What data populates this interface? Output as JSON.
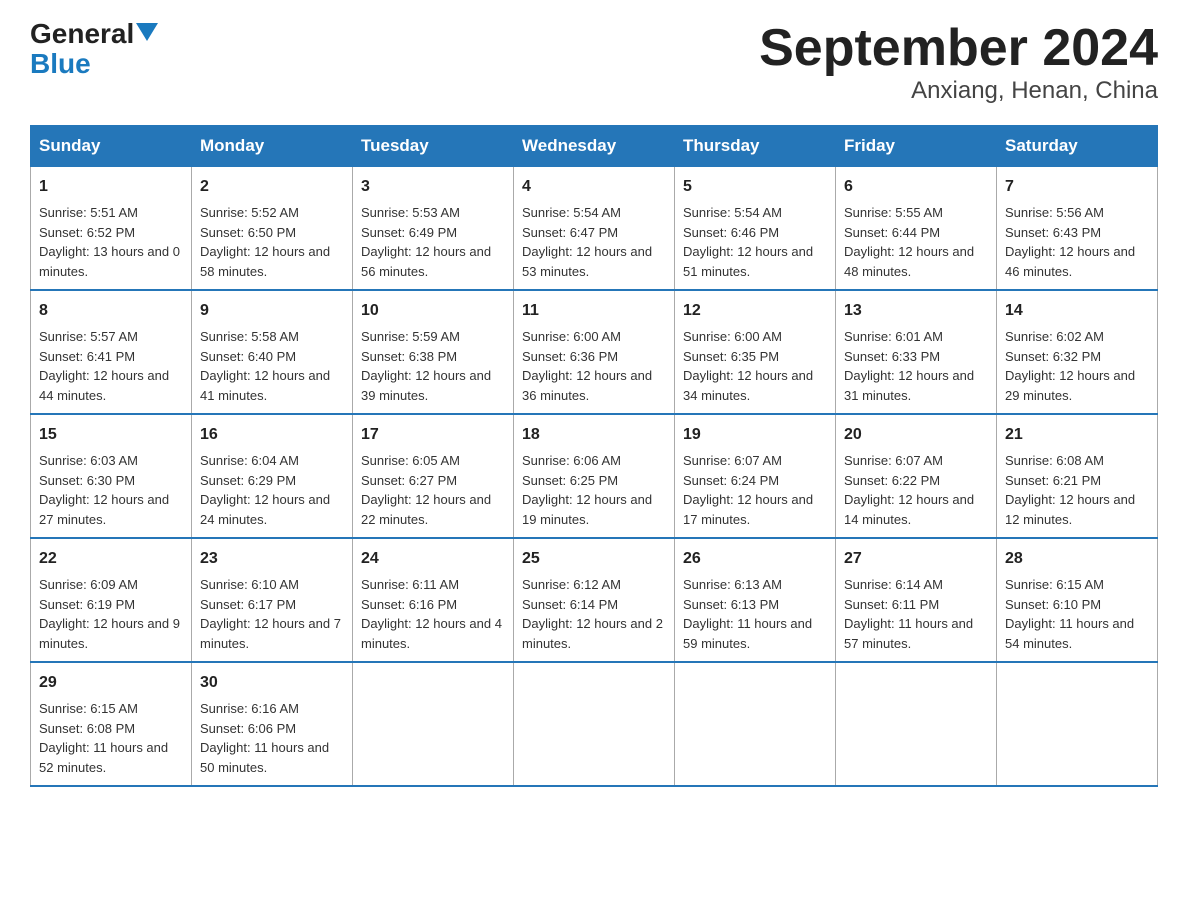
{
  "header": {
    "logo_general": "General",
    "logo_blue": "Blue",
    "title": "September 2024",
    "subtitle": "Anxiang, Henan, China"
  },
  "weekdays": [
    "Sunday",
    "Monday",
    "Tuesday",
    "Wednesday",
    "Thursday",
    "Friday",
    "Saturday"
  ],
  "weeks": [
    [
      {
        "day": "1",
        "sunrise": "5:51 AM",
        "sunset": "6:52 PM",
        "daylight": "13 hours and 0 minutes."
      },
      {
        "day": "2",
        "sunrise": "5:52 AM",
        "sunset": "6:50 PM",
        "daylight": "12 hours and 58 minutes."
      },
      {
        "day": "3",
        "sunrise": "5:53 AM",
        "sunset": "6:49 PM",
        "daylight": "12 hours and 56 minutes."
      },
      {
        "day": "4",
        "sunrise": "5:54 AM",
        "sunset": "6:47 PM",
        "daylight": "12 hours and 53 minutes."
      },
      {
        "day": "5",
        "sunrise": "5:54 AM",
        "sunset": "6:46 PM",
        "daylight": "12 hours and 51 minutes."
      },
      {
        "day": "6",
        "sunrise": "5:55 AM",
        "sunset": "6:44 PM",
        "daylight": "12 hours and 48 minutes."
      },
      {
        "day": "7",
        "sunrise": "5:56 AM",
        "sunset": "6:43 PM",
        "daylight": "12 hours and 46 minutes."
      }
    ],
    [
      {
        "day": "8",
        "sunrise": "5:57 AM",
        "sunset": "6:41 PM",
        "daylight": "12 hours and 44 minutes."
      },
      {
        "day": "9",
        "sunrise": "5:58 AM",
        "sunset": "6:40 PM",
        "daylight": "12 hours and 41 minutes."
      },
      {
        "day": "10",
        "sunrise": "5:59 AM",
        "sunset": "6:38 PM",
        "daylight": "12 hours and 39 minutes."
      },
      {
        "day": "11",
        "sunrise": "6:00 AM",
        "sunset": "6:36 PM",
        "daylight": "12 hours and 36 minutes."
      },
      {
        "day": "12",
        "sunrise": "6:00 AM",
        "sunset": "6:35 PM",
        "daylight": "12 hours and 34 minutes."
      },
      {
        "day": "13",
        "sunrise": "6:01 AM",
        "sunset": "6:33 PM",
        "daylight": "12 hours and 31 minutes."
      },
      {
        "day": "14",
        "sunrise": "6:02 AM",
        "sunset": "6:32 PM",
        "daylight": "12 hours and 29 minutes."
      }
    ],
    [
      {
        "day": "15",
        "sunrise": "6:03 AM",
        "sunset": "6:30 PM",
        "daylight": "12 hours and 27 minutes."
      },
      {
        "day": "16",
        "sunrise": "6:04 AM",
        "sunset": "6:29 PM",
        "daylight": "12 hours and 24 minutes."
      },
      {
        "day": "17",
        "sunrise": "6:05 AM",
        "sunset": "6:27 PM",
        "daylight": "12 hours and 22 minutes."
      },
      {
        "day": "18",
        "sunrise": "6:06 AM",
        "sunset": "6:25 PM",
        "daylight": "12 hours and 19 minutes."
      },
      {
        "day": "19",
        "sunrise": "6:07 AM",
        "sunset": "6:24 PM",
        "daylight": "12 hours and 17 minutes."
      },
      {
        "day": "20",
        "sunrise": "6:07 AM",
        "sunset": "6:22 PM",
        "daylight": "12 hours and 14 minutes."
      },
      {
        "day": "21",
        "sunrise": "6:08 AM",
        "sunset": "6:21 PM",
        "daylight": "12 hours and 12 minutes."
      }
    ],
    [
      {
        "day": "22",
        "sunrise": "6:09 AM",
        "sunset": "6:19 PM",
        "daylight": "12 hours and 9 minutes."
      },
      {
        "day": "23",
        "sunrise": "6:10 AM",
        "sunset": "6:17 PM",
        "daylight": "12 hours and 7 minutes."
      },
      {
        "day": "24",
        "sunrise": "6:11 AM",
        "sunset": "6:16 PM",
        "daylight": "12 hours and 4 minutes."
      },
      {
        "day": "25",
        "sunrise": "6:12 AM",
        "sunset": "6:14 PM",
        "daylight": "12 hours and 2 minutes."
      },
      {
        "day": "26",
        "sunrise": "6:13 AM",
        "sunset": "6:13 PM",
        "daylight": "11 hours and 59 minutes."
      },
      {
        "day": "27",
        "sunrise": "6:14 AM",
        "sunset": "6:11 PM",
        "daylight": "11 hours and 57 minutes."
      },
      {
        "day": "28",
        "sunrise": "6:15 AM",
        "sunset": "6:10 PM",
        "daylight": "11 hours and 54 minutes."
      }
    ],
    [
      {
        "day": "29",
        "sunrise": "6:15 AM",
        "sunset": "6:08 PM",
        "daylight": "11 hours and 52 minutes."
      },
      {
        "day": "30",
        "sunrise": "6:16 AM",
        "sunset": "6:06 PM",
        "daylight": "11 hours and 50 minutes."
      },
      null,
      null,
      null,
      null,
      null
    ]
  ]
}
